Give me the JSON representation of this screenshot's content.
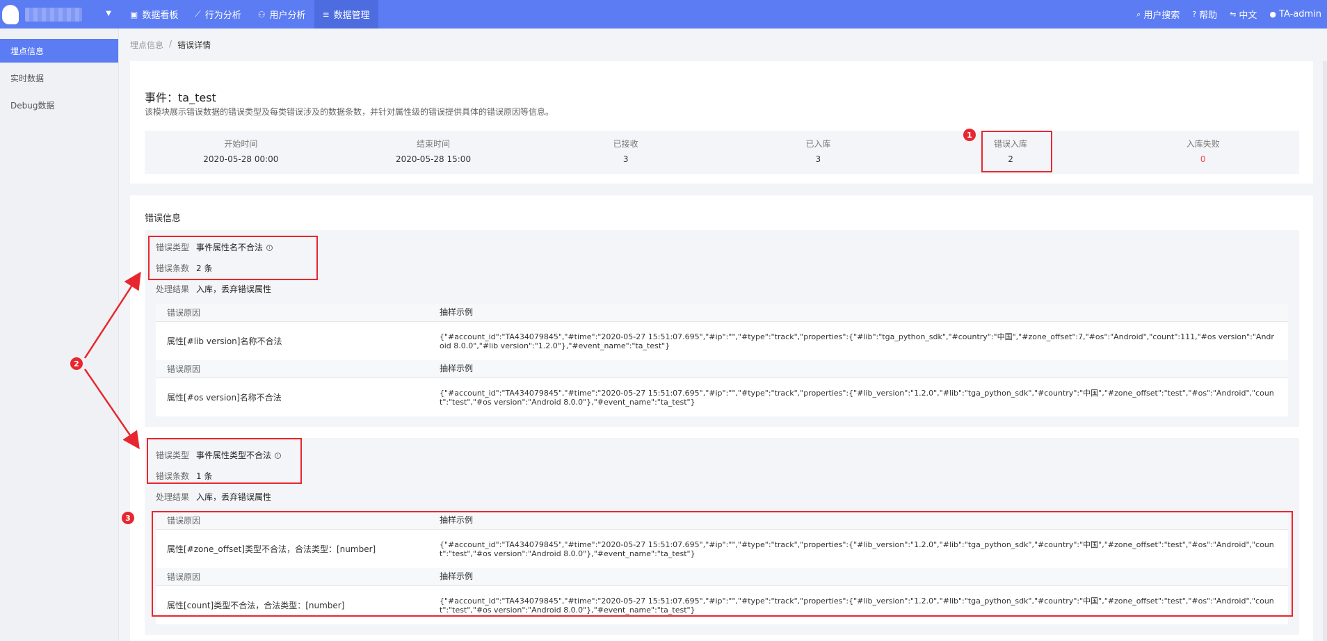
{
  "topbar": {
    "nav": [
      {
        "icon": "dashboard-icon",
        "glyph": "▣",
        "label": "数据看板"
      },
      {
        "icon": "line-chart-icon",
        "glyph": "⟋",
        "label": "行为分析"
      },
      {
        "icon": "user-icon",
        "glyph": "⚇",
        "label": "用户分析"
      },
      {
        "icon": "database-icon",
        "glyph": "≡",
        "label": "数据管理"
      }
    ],
    "right": [
      {
        "icon": "search-icon",
        "glyph": "⌕",
        "label": "用户搜索"
      },
      {
        "icon": "help-icon",
        "glyph": "?",
        "label": "帮助"
      },
      {
        "icon": "language-icon",
        "glyph": "⇋",
        "label": "中文"
      },
      {
        "icon": "account-icon",
        "glyph": "●",
        "label": "TA-admin"
      }
    ],
    "accent": "#5b7cf2"
  },
  "sidebar": {
    "items": [
      {
        "label": "埋点信息",
        "active": true
      },
      {
        "label": "实时数据",
        "active": false
      },
      {
        "label": "Debug数据",
        "active": false
      }
    ]
  },
  "breadcrumb": {
    "parent": "埋点信息",
    "separator": "/",
    "current": "错误详情"
  },
  "event": {
    "title": "事件：ta_test",
    "description": "该模块展示错误数据的错误类型及每类错误涉及的数据条数，并针对属性级的错误提供具体的错误原因等信息。"
  },
  "stats": [
    {
      "label": "开始时间",
      "value": "2020-05-28 00:00"
    },
    {
      "label": "结束时间",
      "value": "2020-05-28 15:00"
    },
    {
      "label": "已接收",
      "value": "3"
    },
    {
      "label": "已入库",
      "value": "3"
    },
    {
      "label": "错误入库",
      "value": "2"
    },
    {
      "label": "入库失败",
      "value": "0"
    }
  ],
  "errors": {
    "section_title": "错误信息",
    "labels": {
      "type": "错误类型",
      "count": "错误条数",
      "result": "处理结果",
      "reason": "错误原因",
      "sample": "抽样示例"
    },
    "groups": [
      {
        "type": "事件属性名不合法",
        "count": "2 条",
        "result": "入库，丢弃错误属性",
        "rows": [
          {
            "reason": "属性[#lib version]名称不合法",
            "sample": "{\"#account_id\":\"TA434079845\",\"#time\":\"2020-05-27 15:51:07.695\",\"#ip\":\"\",\"#type\":\"track\",\"properties\":{\"#lib\":\"tga_python_sdk\",\"#country\":\"中国\",\"#zone_offset\":7,\"#os\":\"Android\",\"count\":111,\"#os version\":\"Android 8.0.0\",\"#lib version\":\"1.2.0\"},\"#event_name\":\"ta_test\"}"
          },
          {
            "reason": "属性[#os version]名称不合法",
            "sample": "{\"#account_id\":\"TA434079845\",\"#time\":\"2020-05-27 15:51:07.695\",\"#ip\":\"\",\"#type\":\"track\",\"properties\":{\"#lib_version\":\"1.2.0\",\"#lib\":\"tga_python_sdk\",\"#country\":\"中国\",\"#zone_offset\":\"test\",\"#os\":\"Android\",\"count\":\"test\",\"#os version\":\"Android 8.0.0\"},\"#event_name\":\"ta_test\"}"
          }
        ]
      },
      {
        "type": "事件属性类型不合法",
        "count": "1 条",
        "result": "入库，丢弃错误属性",
        "rows": [
          {
            "reason": "属性[#zone_offset]类型不合法，合法类型：[number]",
            "sample": "{\"#account_id\":\"TA434079845\",\"#time\":\"2020-05-27 15:51:07.695\",\"#ip\":\"\",\"#type\":\"track\",\"properties\":{\"#lib_version\":\"1.2.0\",\"#lib\":\"tga_python_sdk\",\"#country\":\"中国\",\"#zone_offset\":\"test\",\"#os\":\"Android\",\"count\":\"test\",\"#os version\":\"Android 8.0.0\"},\"#event_name\":\"ta_test\"}"
          },
          {
            "reason": "属性[count]类型不合法，合法类型：[number]",
            "sample": "{\"#account_id\":\"TA434079845\",\"#time\":\"2020-05-27 15:51:07.695\",\"#ip\":\"\",\"#type\":\"track\",\"properties\":{\"#lib_version\":\"1.2.0\",\"#lib\":\"tga_python_sdk\",\"#country\":\"中国\",\"#zone_offset\":\"test\",\"#os\":\"Android\",\"count\":\"test\",\"#os version\":\"Android 8.0.0\"},\"#event_name\":\"ta_test\"}"
          }
        ]
      }
    ]
  },
  "annotations": {
    "badges": [
      "1",
      "2",
      "3"
    ],
    "color": "#e8262f"
  }
}
